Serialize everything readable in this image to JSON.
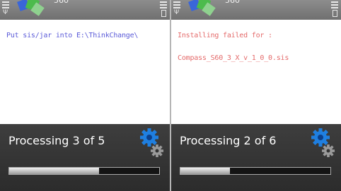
{
  "screens": [
    {
      "model": "560",
      "messages": [
        "Put sis/jar into E:\\ThinkChange\\"
      ],
      "status_text": "Processing 3 of 5",
      "progress": 0.6
    },
    {
      "model": "560",
      "messages": [
        "Installing failed for :",
        "Compass_S60_3_X_v_1_0_0.sis"
      ],
      "status_text": "Processing 2 of 6",
      "progress": 0.33
    }
  ],
  "colors": {
    "info_text": "#5a5ad8",
    "error_text": "#e46a6a",
    "gear_blue": "#1f7fe0",
    "gear_gray": "#9a9a9a",
    "panel_bg": "#363636"
  },
  "icons": [
    "signal-icon",
    "battery-icon",
    "app-logo-icon",
    "processing-gears-icon"
  ]
}
